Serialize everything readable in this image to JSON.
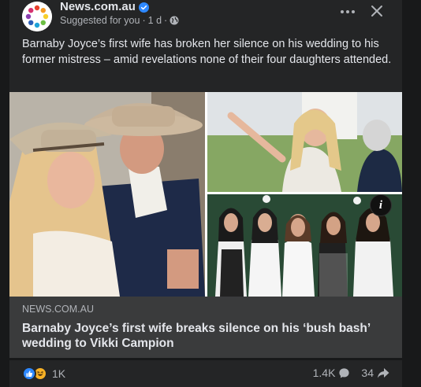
{
  "post": {
    "page_name": "News.com.au",
    "meta": {
      "suggested": "Suggested for you",
      "separator": "·",
      "age": "1 d",
      "separator2": "·"
    },
    "caption": "Barnaby Joyce’s first wife has broken her silence on his wedding to his former mistress – amid revelations none of their four daughters attended.",
    "link": {
      "domain": "NEWS.COM.AU",
      "title": "Barnaby Joyce’s first wife breaks silence on his ‘bush bash’ wedding to Vikki Campion"
    },
    "reactions": {
      "count": "1K"
    },
    "comments": {
      "count": "1.4K"
    },
    "shares": {
      "count": "34"
    }
  },
  "colors": {
    "background": "#18191a",
    "card": "#242526",
    "link_box": "#3a3b3c",
    "verified": "#2d88ff",
    "like": "#2d88ff",
    "haha": "#f7b125"
  },
  "icons": [
    "verified-badge-icon",
    "globe-icon",
    "more-options-icon",
    "close-icon",
    "info-icon",
    "like-reaction-icon",
    "haha-reaction-icon",
    "comment-icon",
    "share-icon"
  ]
}
